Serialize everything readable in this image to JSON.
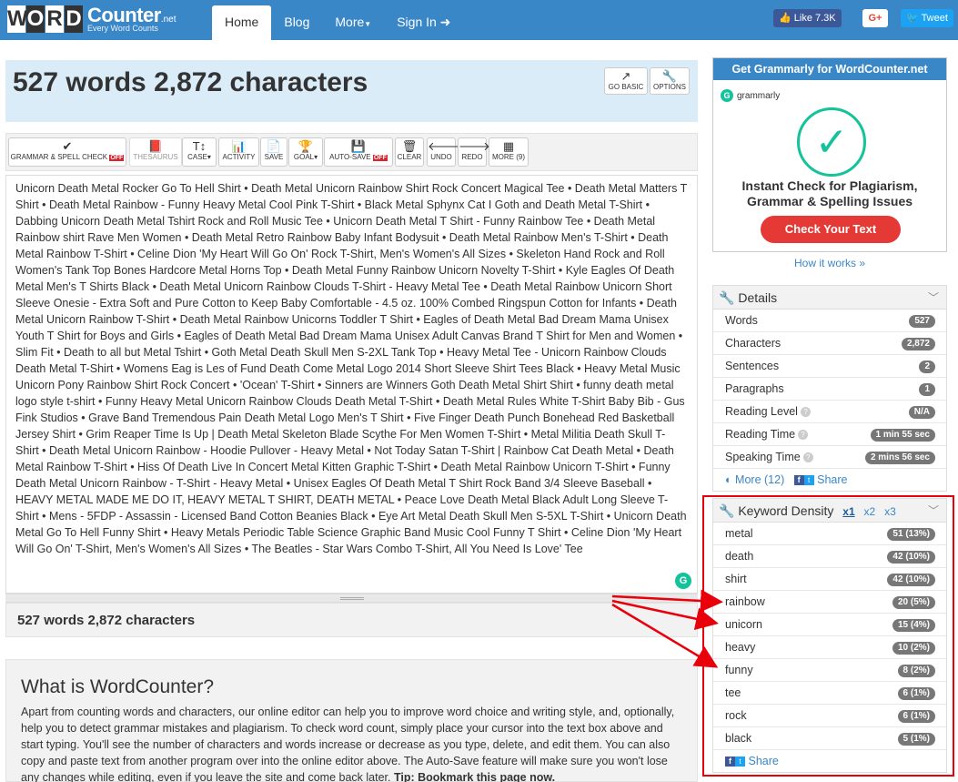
{
  "nav": {
    "logo_letters": [
      "W",
      "O",
      "R",
      "D"
    ],
    "logo_word": "Counter",
    "logo_tld": ".net",
    "logo_tagline": "Every Word Counts",
    "items": [
      "Home",
      "Blog",
      "More",
      "Sign In"
    ],
    "fb_label": "Like 7.3K",
    "gplus_label": "G+",
    "tw_label": "Tweet"
  },
  "header": {
    "count_title": "527 words 2,872 characters",
    "go_basic": "GO BASIC",
    "options": "OPTIONS"
  },
  "toolbar": {
    "grammar": "GRAMMAR & SPELL CHECK",
    "off": "OFF",
    "thesaurus": "THESAURUS",
    "case": "CASE",
    "activity": "ACTIVITY",
    "save": "SAVE",
    "goal": "GOAL",
    "autosave": "AUTO-SAVE",
    "clear": "CLEAR",
    "undo": "UNDO",
    "redo": "REDO",
    "more": "MORE (9)"
  },
  "editor": {
    "text": "Unicorn Death Metal Rocker Go To Hell Shirt • Death Metal Unicorn Rainbow Shirt Rock Concert Magical Tee • Death Metal Matters T Shirt • Death Metal Rainbow - Funny Heavy Metal Cool Pink T-Shirt • Black Metal Sphynx Cat I Goth and Death Metal T-Shirt • Dabbing Unicorn Death Metal Tshirt Rock and Roll Music Tee • Unicorn Death Metal T Shirt - Funny Rainbow Tee • Death Metal Rainbow shirt Rave Men Women • Death Metal Retro Rainbow Baby Infant Bodysuit • Death Metal Rainbow Men's T-Shirt • Death Metal Rainbow T-Shirt • Celine Dion 'My Heart Will Go On' Rock T-Shirt, Men's Women's All Sizes • Skeleton Hand Rock and Roll Women's Tank Top Bones Hardcore Metal Horns Top • Death Metal Funny Rainbow Unicorn Novelty T-Shirt • Kyle Eagles Of Death Metal Men's T Shirts Black • Death Metal Unicorn Rainbow Clouds T-Shirt - Heavy Metal Tee • Death Metal Rainbow Unicorn Short Sleeve Onesie - Extra Soft and Pure Cotton to Keep Baby Comfortable - 4.5 oz. 100% Combed Ringspun Cotton for Infants • Death Metal Unicorn Rainbow T-Shirt • Death Metal Rainbow Unicorns Toddler T Shirt • Eagles of Death Metal Bad Dream Mama Unisex Youth T Shirt for Boys and Girls • Eagles of Death Metal Bad Dream Mama Unisex Adult Canvas Brand T Shirt for Men and Women • Slim Fit • Death to all but Metal Tshirt • Goth Metal Death Skull Men S-2XL Tank Top • Heavy Metal Tee - Unicorn Rainbow Clouds Death Metal T-Shirt • Womens Eag is Les of Fund Death Come Metal Logo 2014 Short Sleeve Shirt Tees Black • Heavy Metal Music Unicorn Pony Rainbow Shirt Rock Concert • 'Ocean' T-Shirt • Sinners are Winners Goth Death Metal Shirt Shirt • funny death metal logo style t-shirt • Funny Heavy Metal Unicorn Rainbow Clouds Death Metal T-Shirt • Death Metal Rules White T-Shirt Baby Bib - Gus Fink Studios • Grave Band Tremendous Pain Death Metal Logo Men's T Shirt • Five Finger Death Punch Bonehead Red Basketball Jersey Shirt • Grim Reaper Time Is Up | Death Metal Skeleton Blade Scythe For Men Women T-Shirt • Metal Militia Death Skull T-Shirt • Death Metal Unicorn Rainbow - Hoodie Pullover - Heavy Metal • Not Today Satan T-Shirt | Rainbow Cat Death Metal • Death Metal Rainbow T-Shirt • Hiss Of Death Live In Concert Metal Kitten Graphic T-Shirt • Death Metal Rainbow Unicorn T-Shirt • Funny Death Metal Unicorn Rainbow - T-Shirt - Heavy Metal • Unisex Eagles Of Death Metal T Shirt Rock Band 3/4 Sleeve Baseball • HEAVY METAL MADE ME DO IT, HEAVY METAL T SHIRT, DEATH METAL • Peace Love Death Metal Black Adult Long Sleeve T-Shirt • Mens - 5FDP - Assassin - Licensed Band Cotton Beanies Black • Eye Art Metal Death Skull Men S-5XL T-Shirt • Unicorn Death Metal Go To Hell Funny Shirt • Heavy Metals Periodic Table Science Graphic Band Music Cool Funny T Shirt • Celine Dion 'My Heart Will Go On' T-Shirt, Men's Women's All Sizes • The Beatles - Star Wars Combo T-Shirt, All You Need Is Love' Tee",
    "footer_count": "527 words 2,872 characters"
  },
  "about": {
    "title": "What is WordCounter?",
    "body": "Apart from counting words and characters, our online editor can help you to improve word choice and writing style, and, optionally, help you to detect grammar mistakes and plagiarism. To check word count, simply place your cursor into the text box above and start typing. You'll see the number of characters and words increase or decrease as you type, delete, and edit them. You can also copy and paste text from another program over into the online editor above. The Auto-Save feature will make sure you won't lose any changes while editing, even if you leave the site and come back later. ",
    "tip": "Tip: Bookmark this page now."
  },
  "ad": {
    "head": "Get Grammarly for WordCounter.net",
    "brand": "grammarly",
    "title": "Instant Check for Plagiarism, Grammar & Spelling Issues",
    "button": "Check Your Text",
    "how": "How it works »"
  },
  "details": {
    "title": "Details",
    "rows": [
      {
        "label": "Words",
        "value": "527"
      },
      {
        "label": "Characters",
        "value": "2,872"
      },
      {
        "label": "Sentences",
        "value": "2"
      },
      {
        "label": "Paragraphs",
        "value": "1"
      },
      {
        "label": "Reading Level",
        "value": "N/A"
      },
      {
        "label": "Reading Time",
        "value": "1 min 55 sec"
      },
      {
        "label": "Speaking Time",
        "value": "2 mins 56 sec"
      }
    ],
    "more": "More (12)",
    "share": "Share"
  },
  "density": {
    "title": "Keyword Density",
    "x1": "x1",
    "x2": "x2",
    "x3": "x3",
    "rows": [
      {
        "word": "metal",
        "value": "51 (13%)"
      },
      {
        "word": "death",
        "value": "42 (10%)"
      },
      {
        "word": "shirt",
        "value": "42 (10%)"
      },
      {
        "word": "rainbow",
        "value": "20 (5%)"
      },
      {
        "word": "unicorn",
        "value": "15 (4%)"
      },
      {
        "word": "heavy",
        "value": "10 (2%)"
      },
      {
        "word": "funny",
        "value": "8 (2%)"
      },
      {
        "word": "tee",
        "value": "6 (1%)"
      },
      {
        "word": "rock",
        "value": "6 (1%)"
      },
      {
        "word": "black",
        "value": "5 (1%)"
      }
    ],
    "share": "Share"
  },
  "colors": {
    "brand_blue": "#3a87c8",
    "grammarly_green": "#15c39a",
    "highlight_red": "#e8000b"
  }
}
